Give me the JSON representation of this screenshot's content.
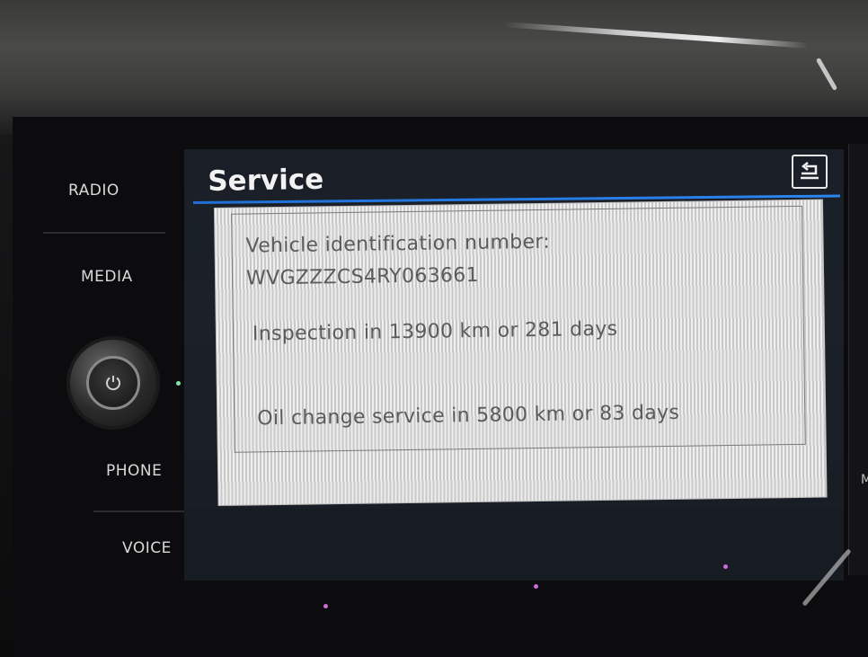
{
  "side_buttons": {
    "radio": "RADIO",
    "media": "MEDIA",
    "phone": "PHONE",
    "voice": "VOICE"
  },
  "screen": {
    "title": "Service",
    "vin_label": "Vehicle identification number:",
    "vin_value": "WVGZZZCS4RY063661",
    "inspection": "Inspection in 13900 km or 281 days",
    "oil_change": "Oil change service in 5800 km or 83 days"
  },
  "right_edge_letter": "M",
  "colors": {
    "accent_line": "#2b86f0",
    "screen_bg": "#1a1f27",
    "panel_bg": "#d9d9d9",
    "panel_text": "#5b5b5b",
    "knob_indicator": "#7fe7a6",
    "ambient_dot": "#d06bdc"
  },
  "icons": {
    "back": "back-arrow-icon",
    "power": "power-icon"
  }
}
